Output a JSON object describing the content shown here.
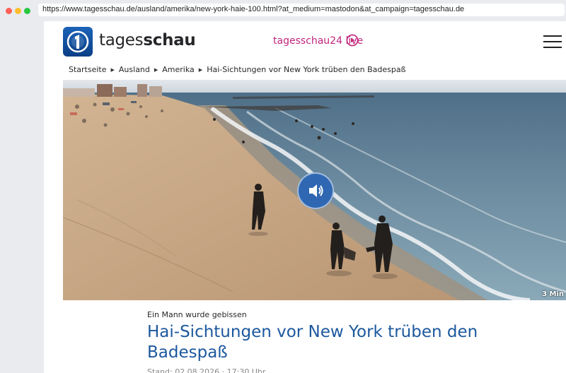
{
  "browser": {
    "url": "https://www.tagesschau.de/ausland/amerika/new-york-haie-100.html?at_medium=mastodon&at_campaign=tagesschau.de"
  },
  "header": {
    "brand_prefix": "tages",
    "brand_bold": "schau",
    "live_label": "tagesschau24 live",
    "accent_color": "#c1257d"
  },
  "breadcrumb": [
    "Startseite",
    "Ausland",
    "Amerika",
    "Hai-Sichtungen vor New York trüben den Badespaß"
  ],
  "video": {
    "duration": "3 Min"
  },
  "article": {
    "kicker": "Ein Mann wurde gebissen",
    "headline": "Hai-Sichtungen vor New York trüben den Badespaß",
    "dateline": "Stand: 02.08.2026 · 17:30 Uhr"
  },
  "icons": {
    "logo": "ard-one-icon",
    "live": "play-circle-icon",
    "menu": "hamburger-menu-icon",
    "sound": "speaker-icon"
  }
}
